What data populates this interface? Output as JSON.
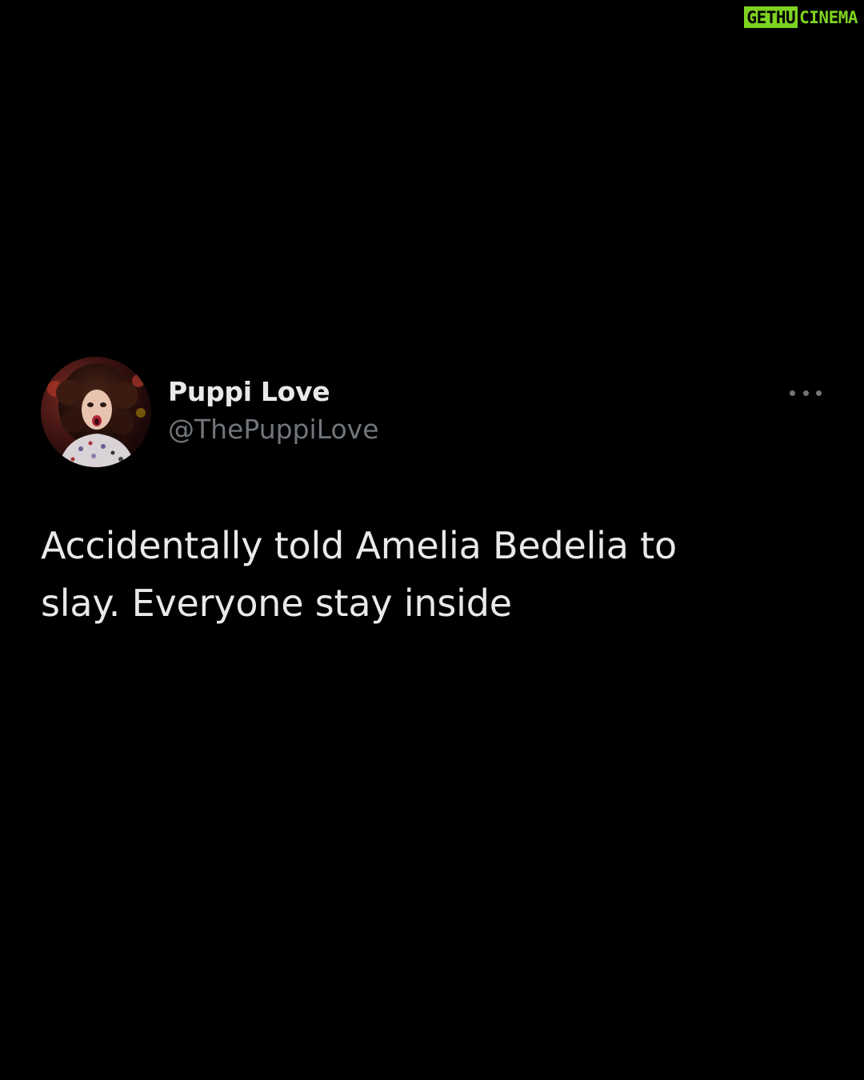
{
  "watermark": {
    "boxed": "GETHU",
    "text": "CINEMA",
    "color": "#7ed321"
  },
  "tweet": {
    "display_name": "Puppi Love",
    "handle": "@ThePuppiLove",
    "text": "Accidentally told Amelia Bedelia to slay. Everyone stay inside",
    "more_icon": "more-horizontal-icon",
    "avatar": "profile-photo"
  },
  "colors": {
    "background": "#000000",
    "primary_text": "#e7e9ea",
    "secondary_text": "#71767b"
  }
}
